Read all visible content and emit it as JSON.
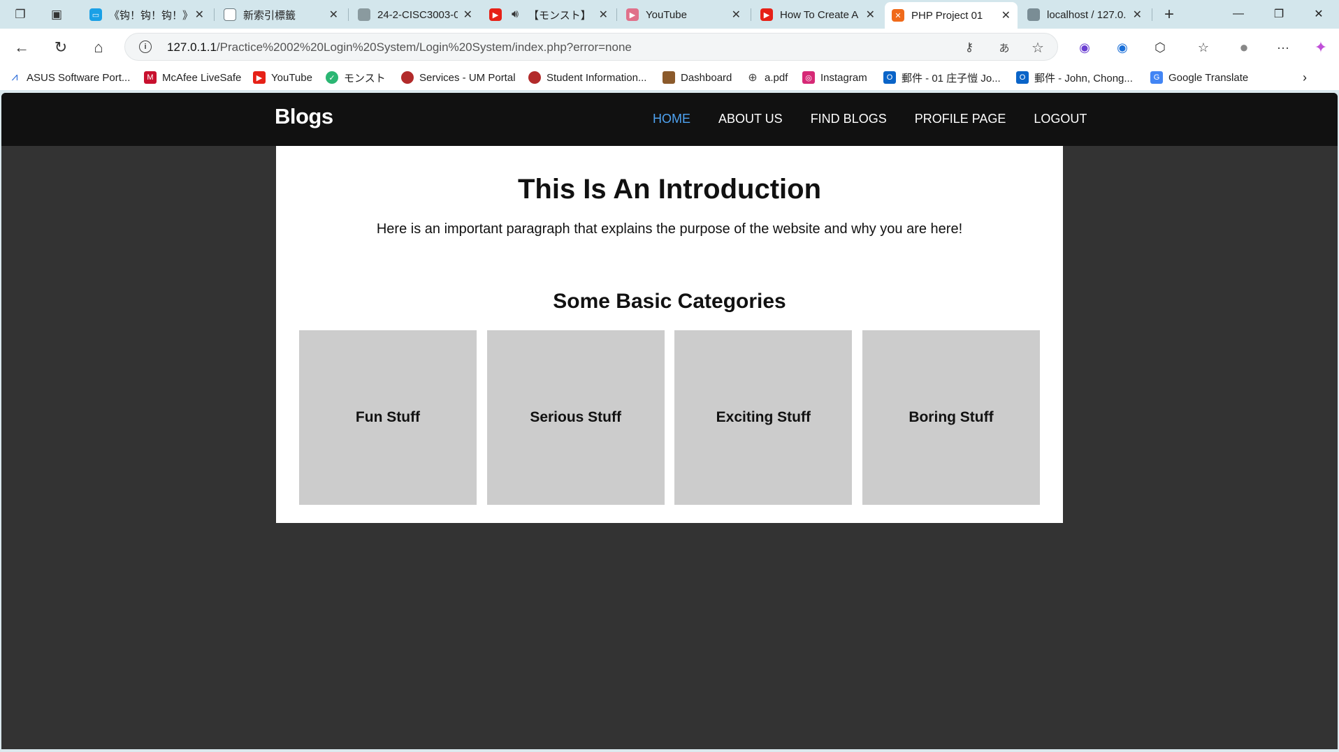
{
  "browser": {
    "tabs": [
      {
        "label": "《钩！钩！钩！》",
        "favicon_color": "#1aa0e6",
        "favicon": "tv-icon"
      },
      {
        "label": "新索引標籤",
        "favicon_color": "#6b7a80",
        "favicon": "newtab-icon"
      },
      {
        "label": "24-2-CISC3003-0",
        "favicon_color": "#8a9a9f",
        "favicon": "course-icon"
      },
      {
        "label": "【モンスト】",
        "favicon_color": "#e62117",
        "favicon": "youtube-icon"
      },
      {
        "label": "YouTube",
        "favicon_color": "#e0708a",
        "favicon": "youtube-icon"
      },
      {
        "label": "How To Create A",
        "favicon_color": "#e62117",
        "favicon": "youtube-icon"
      },
      {
        "label": "PHP Project 01",
        "favicon_color": "#f06a1a",
        "favicon": "xampp-icon"
      },
      {
        "label": "localhost / 127.0.",
        "favicon_color": "#7a8d95",
        "favicon": "phpmyadmin-icon"
      }
    ],
    "active_tab_index": 6,
    "url_host": "127.0.1.1",
    "url_path": "/Practice%2002%20Login%20System/Login%20System/index.php?error=none",
    "bookmarks": [
      {
        "label": "ASUS Software Port...",
        "color": "#2a6ad8"
      },
      {
        "label": "McAfee LiveSafe",
        "color": "#c8102e"
      },
      {
        "label": "YouTube",
        "color": "#e62117"
      },
      {
        "label": "モンスト",
        "color": "#2bb673"
      },
      {
        "label": "Services - UM Portal",
        "color": "#b22a2a"
      },
      {
        "label": "Student Information...",
        "color": "#b22a2a"
      },
      {
        "label": "Dashboard",
        "color": "#8b5a2b"
      },
      {
        "label": "a.pdf",
        "color": "#444444"
      },
      {
        "label": "Instagram",
        "color": "#d62976"
      },
      {
        "label": "郵件 - 01 庄子愷 Jo...",
        "color": "#0a64c8"
      },
      {
        "label": "郵件 - John, Chong...",
        "color": "#0a64c8"
      },
      {
        "label": "Google Translate",
        "color": "#4285f4"
      }
    ]
  },
  "site": {
    "brand": "Blogs",
    "nav": [
      {
        "label": "HOME",
        "active": true
      },
      {
        "label": "ABOUT US",
        "active": false
      },
      {
        "label": "FIND BLOGS",
        "active": false
      },
      {
        "label": "PROFILE PAGE",
        "active": false
      },
      {
        "label": "LOGOUT",
        "active": false
      }
    ],
    "intro_title": "This Is An Introduction",
    "intro_text": "Here is an important paragraph that explains the purpose of the website and why you are here!",
    "categories_title": "Some Basic Categories",
    "categories": [
      "Fun Stuff",
      "Serious Stuff",
      "Exciting Stuff",
      "Boring Stuff"
    ],
    "colors": {
      "nav_bg": "#111111",
      "page_bg": "#333333",
      "active_link": "#4ea3f2",
      "card_bg": "#cccccc"
    }
  }
}
